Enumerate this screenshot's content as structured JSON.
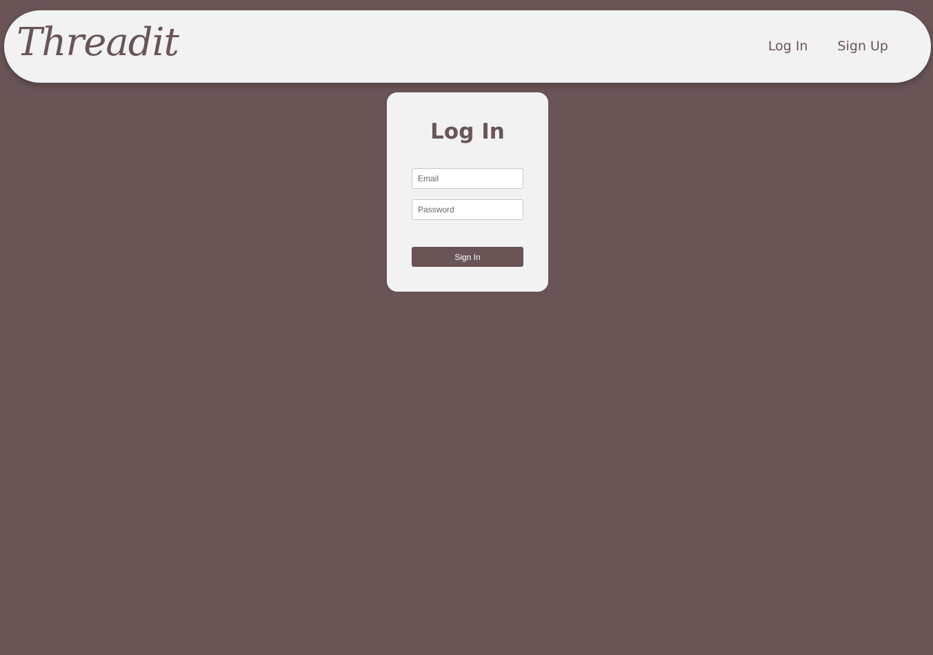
{
  "app": {
    "logo_text": "Threadit"
  },
  "nav": {
    "links": [
      {
        "label": "Log In"
      },
      {
        "label": "Sign Up"
      }
    ]
  },
  "login": {
    "title": "Log In",
    "email": {
      "placeholder": "Email",
      "value": ""
    },
    "password": {
      "placeholder": "Password",
      "value": ""
    },
    "submit_label": "Sign In"
  },
  "colors": {
    "background": "#695556",
    "surface": "#f2f2f2",
    "accent": "#695556",
    "button_text": "#ffffff"
  }
}
